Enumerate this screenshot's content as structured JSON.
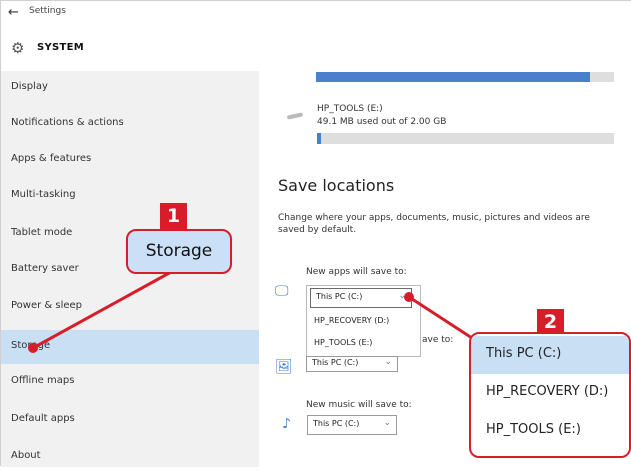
{
  "window": {
    "app_title": "Settings",
    "section_title": "SYSTEM"
  },
  "sidebar": {
    "items": [
      {
        "label": "Display"
      },
      {
        "label": "Notifications & actions"
      },
      {
        "label": "Apps & features"
      },
      {
        "label": "Multi-tasking"
      },
      {
        "label": "Tablet mode"
      },
      {
        "label": "Battery saver"
      },
      {
        "label": "Power & sleep"
      },
      {
        "label": "Storage"
      },
      {
        "label": "Offline maps"
      },
      {
        "label": "Default apps"
      },
      {
        "label": "About"
      }
    ],
    "active_item": "Storage"
  },
  "drive": {
    "name": "HP_TOOLS (E:)",
    "usage": "49.1 MB used out of 2.00 GB"
  },
  "save_locations": {
    "title": "Save locations",
    "description": "Change where your apps, documents, music, pictures and videos are saved by default.",
    "apps_label": "New apps will save to:",
    "apps_value": "This PC (C:)",
    "apps_options": [
      "This PC (C:)",
      "HP_RECOVERY (D:)",
      "HP_TOOLS (E:)"
    ],
    "partial_label": "ave to:",
    "pictures_value": "This PC (C:)",
    "music_label": "New music will save to:",
    "music_value": "This PC (C:)"
  },
  "callouts": {
    "step1_number": "1",
    "step1_label": "Storage",
    "step2_number": "2",
    "step2_options": [
      "This PC (C:)",
      "HP_RECOVERY (D:)",
      "HP_TOOLS (E:)"
    ]
  },
  "icons": {
    "back": "back-arrow-icon",
    "system": "gear-icon",
    "apps": "monitor-icon",
    "pictures": "image-icon",
    "music": "music-note-icon"
  },
  "colors": {
    "accent": "#4a7fcd",
    "selection": "#c9dff4",
    "callout": "#d71d2a"
  }
}
